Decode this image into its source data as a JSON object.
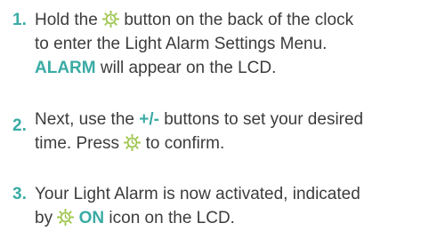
{
  "colors": {
    "accent": "#3aaba4",
    "text": "#3c3c3c"
  },
  "icons": {
    "light_alarm": "sun-clock-icon"
  },
  "steps": [
    {
      "number": "1.",
      "line1_a": "Hold the",
      "line1_b": "button on the back of the clock",
      "line2": "to enter the Light Alarm Settings Menu.",
      "keyword": "ALARM",
      "line3_rest": "will appear on the LCD."
    },
    {
      "number": "2.",
      "line1_a": "Next, use the",
      "buttons": "+/-",
      "line1_b": "buttons to set your desired",
      "line2_a": "time. Press",
      "line2_b": "to confirm."
    },
    {
      "number": "3.",
      "line1": "Your Light Alarm is now activated, indicated",
      "line2_a": "by",
      "on_label": "ON",
      "line2_b": "icon on the LCD."
    }
  ]
}
